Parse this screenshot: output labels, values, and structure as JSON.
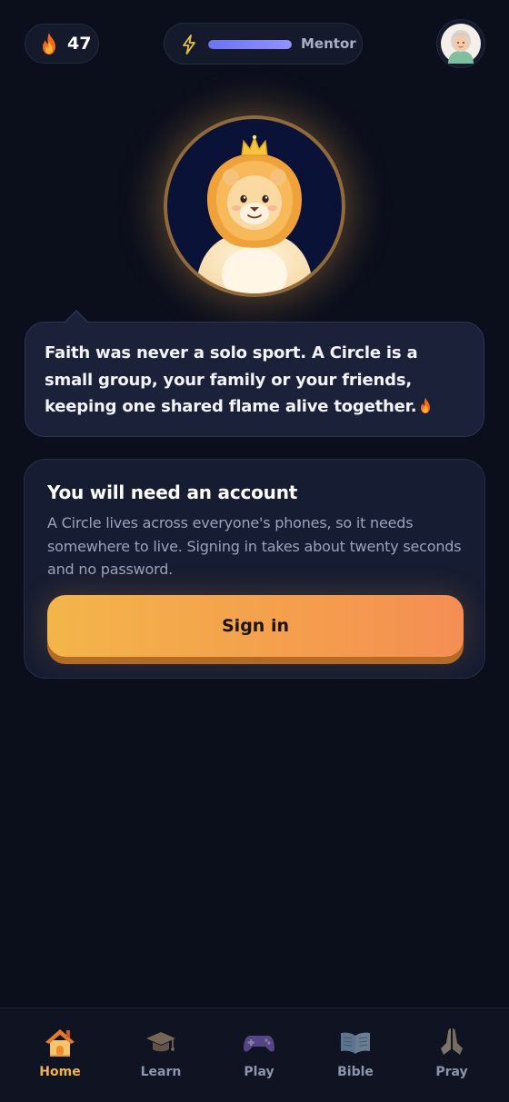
{
  "header": {
    "streak_count": "47",
    "xp_progress_percent": 100,
    "rank_label": "Mentor"
  },
  "mascot": {
    "name": "lion-with-crown"
  },
  "bubble": {
    "message": "Faith was never a solo sport. A Circle is a small group, your family or your friends, keeping one shared flame alive together."
  },
  "account_card": {
    "title": "You will need an account",
    "body": "A Circle lives across everyone's phones, so it needs somewhere to live. Signing in takes about twenty seconds and no password.",
    "button_label": "Sign in"
  },
  "nav": {
    "items": [
      {
        "label": "Home",
        "icon": "house-icon",
        "active": true
      },
      {
        "label": "Learn",
        "icon": "graduation-cap-icon",
        "active": false
      },
      {
        "label": "Play",
        "icon": "gamepad-icon",
        "active": false
      },
      {
        "label": "Bible",
        "icon": "open-book-icon",
        "active": false
      },
      {
        "label": "Pray",
        "icon": "praying-hands-icon",
        "active": false
      }
    ]
  },
  "colors": {
    "background": "#0b0f1c",
    "accent": "#f2b44c",
    "button_gradient_start": "#f3b54a",
    "button_gradient_end": "#f48e55",
    "xp_bar": "#7b80f8"
  }
}
